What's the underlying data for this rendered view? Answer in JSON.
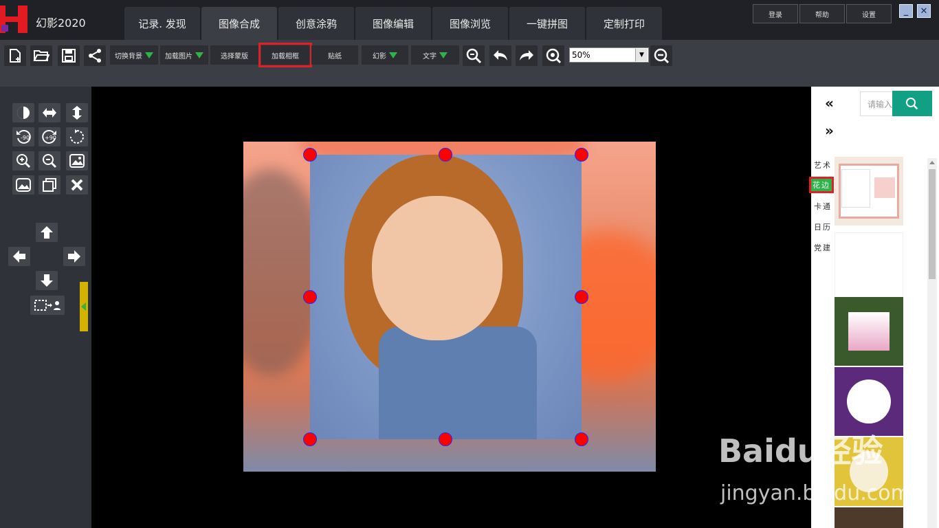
{
  "app": {
    "title": "幻影2020"
  },
  "tabs": [
    {
      "label": "记录. 发现"
    },
    {
      "label": "图像合成"
    },
    {
      "label": "创意涂鸦"
    },
    {
      "label": "图像编辑"
    },
    {
      "label": "图像浏览"
    },
    {
      "label": "一键拼图"
    },
    {
      "label": "定制打印"
    }
  ],
  "active_tab": "图像合成",
  "top_buttons": {
    "login": "登录",
    "help": "帮助",
    "settings": "设置"
  },
  "window_controls": {
    "minimize": "_",
    "close": "✕"
  },
  "toolbar": {
    "switch_bg": "切换背景",
    "load_image": "加载图片",
    "select_template": "选择蒙版",
    "load_frame": "加载相框",
    "sticker": "贴纸",
    "phantom": "幻影",
    "text": "文字",
    "zoom": "50%"
  },
  "right_panel": {
    "search_placeholder": "请输入",
    "prev": "«",
    "next": "»",
    "categories": [
      "艺术",
      "花边",
      "卡通",
      "日历",
      "党建"
    ],
    "selected_category": "花边"
  },
  "thumbnails": [
    {
      "name": "save-the-date-card",
      "color": "#f2e6da"
    },
    {
      "name": "blank-white-frame",
      "color": "#ffffff"
    },
    {
      "name": "daisy-frame",
      "color": "#3d5a2c"
    },
    {
      "name": "pansy-frame-purple",
      "color": "#5b2a7a"
    },
    {
      "name": "pansy-frame-yellow",
      "color": "#e2c43a"
    },
    {
      "name": "flower-frame-partial",
      "color": "#c9593a"
    }
  ],
  "watermark": {
    "main": "Baidu经验",
    "sub": "jingyan.baidu.com"
  },
  "colors": {
    "accent_green": "#2fb24a",
    "highlight_red": "#e31e24",
    "search_teal": "#11a083"
  }
}
